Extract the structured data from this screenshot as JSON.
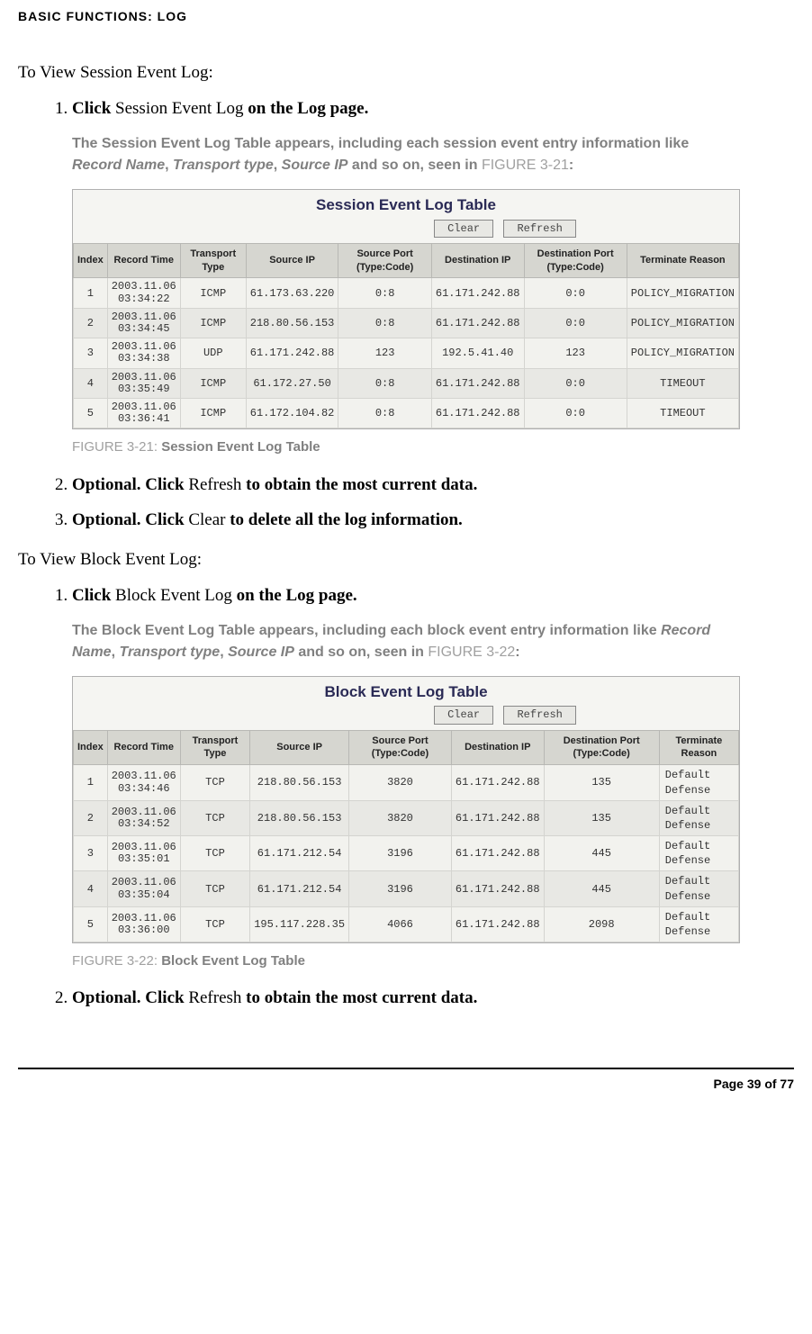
{
  "header": {
    "title": "BASIC FUNCTIONS: LOG"
  },
  "session": {
    "heading": "To View Session Event Log:",
    "step1": {
      "pre": "Click ",
      "mid": "Session Event Log",
      "post": " on the Log page."
    },
    "desc": {
      "text1": "The Session Event Log Table appears, including each session event entry information like ",
      "rn": "Record Name",
      "c1": ", ",
      "tt": "Transport type",
      "c2": ", ",
      "sip": "Source IP",
      "tail": " and so on, seen in ",
      "ref": "FIGURE 3-21",
      "colon": ":"
    },
    "table": {
      "title": "Session Event Log Table",
      "clear": "Clear",
      "refresh": "Refresh",
      "cols": {
        "idx": "Index",
        "rt": "Record Time",
        "tt": "Transport Type",
        "sip": "Source IP",
        "sp": "Source Port (Type:Code)",
        "dip": "Destination IP",
        "dp": "Destination Port (Type:Code)",
        "tr": "Terminate Reason"
      },
      "rows": [
        {
          "i": "1",
          "rt": "2003.11.06 03:34:22",
          "tt": "ICMP",
          "sip": "61.173.63.220",
          "sp": "0:8",
          "dip": "61.171.242.88",
          "dp": "0:0",
          "tr": "POLICY_MIGRATION"
        },
        {
          "i": "2",
          "rt": "2003.11.06 03:34:45",
          "tt": "ICMP",
          "sip": "218.80.56.153",
          "sp": "0:8",
          "dip": "61.171.242.88",
          "dp": "0:0",
          "tr": "POLICY_MIGRATION"
        },
        {
          "i": "3",
          "rt": "2003.11.06 03:34:38",
          "tt": "UDP",
          "sip": "61.171.242.88",
          "sp": "123",
          "dip": "192.5.41.40",
          "dp": "123",
          "tr": "POLICY_MIGRATION"
        },
        {
          "i": "4",
          "rt": "2003.11.06 03:35:49",
          "tt": "ICMP",
          "sip": "61.172.27.50",
          "sp": "0:8",
          "dip": "61.171.242.88",
          "dp": "0:0",
          "tr": "TIMEOUT"
        },
        {
          "i": "5",
          "rt": "2003.11.06 03:36:41",
          "tt": "ICMP",
          "sip": "61.172.104.82",
          "sp": "0:8",
          "dip": "61.171.242.88",
          "dp": "0:0",
          "tr": "TIMEOUT"
        }
      ]
    },
    "figcap": {
      "ref": "FIGURE 3-21: ",
      "title": "Session Event Log Table"
    },
    "step2": {
      "a": "Optional. Click ",
      "b": "Refresh",
      "c": " to obtain the most current data."
    },
    "step3": {
      "a": "Optional. Click ",
      "b": "Clear",
      "c": " to delete all the log information."
    }
  },
  "block": {
    "heading": "To View Block Event Log:",
    "step1": {
      "pre": "Click ",
      "mid": "Block Event Log",
      "post": " on the Log page."
    },
    "desc": {
      "text1": "The Block Event Log Table appears, including each block event entry information like ",
      "rn": "Record Name",
      "c1": ", ",
      "tt": "Transport type",
      "c2": ", ",
      "sip": "Source IP",
      "tail": " and so on, seen in ",
      "ref": "FIGURE 3-22",
      "colon": ":"
    },
    "table": {
      "title": "Block Event Log Table",
      "clear": "Clear",
      "refresh": "Refresh",
      "cols": {
        "idx": "Index",
        "rt": "Record Time",
        "tt": "Transport Type",
        "sip": "Source IP",
        "sp": "Source Port (Type:Code)",
        "dip": "Destination IP",
        "dp": "Destination Port (Type:Code)",
        "tr": "Terminate Reason"
      },
      "rows": [
        {
          "i": "1",
          "rt": "2003.11.06 03:34:46",
          "tt": "TCP",
          "sip": "218.80.56.153",
          "sp": "3820",
          "dip": "61.171.242.88",
          "dp": "135",
          "tr": "Default Defense"
        },
        {
          "i": "2",
          "rt": "2003.11.06 03:34:52",
          "tt": "TCP",
          "sip": "218.80.56.153",
          "sp": "3820",
          "dip": "61.171.242.88",
          "dp": "135",
          "tr": "Default Defense"
        },
        {
          "i": "3",
          "rt": "2003.11.06 03:35:01",
          "tt": "TCP",
          "sip": "61.171.212.54",
          "sp": "3196",
          "dip": "61.171.242.88",
          "dp": "445",
          "tr": "Default Defense"
        },
        {
          "i": "4",
          "rt": "2003.11.06 03:35:04",
          "tt": "TCP",
          "sip": "61.171.212.54",
          "sp": "3196",
          "dip": "61.171.242.88",
          "dp": "445",
          "tr": "Default Defense"
        },
        {
          "i": "5",
          "rt": "2003.11.06 03:36:00",
          "tt": "TCP",
          "sip": "195.117.228.35",
          "sp": "4066",
          "dip": "61.171.242.88",
          "dp": "2098",
          "tr": "Default Defense"
        }
      ]
    },
    "figcap": {
      "ref": "FIGURE 3-22: ",
      "title": "Block Event Log Table"
    },
    "step2": {
      "a": "Optional. Click ",
      "b": "Refresh",
      "c": " to obtain the most current data."
    }
  },
  "footer": {
    "text": "Page 39 of 77"
  }
}
